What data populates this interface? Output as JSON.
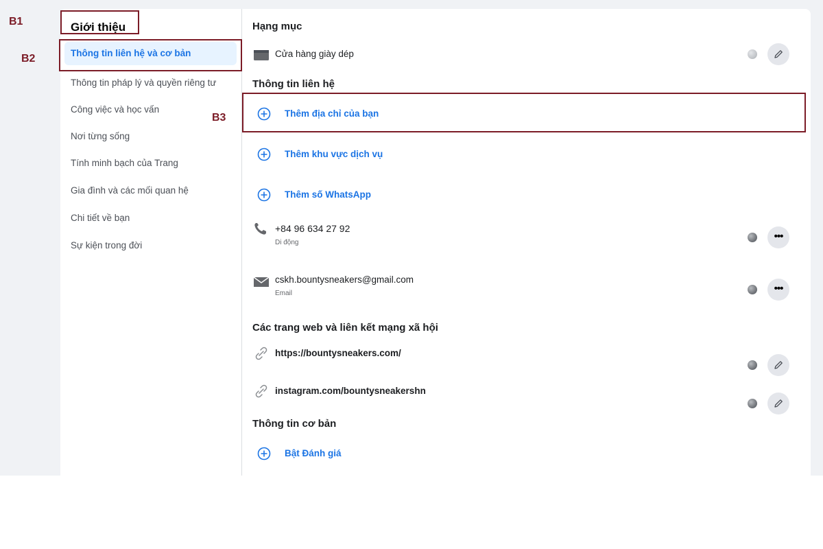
{
  "sidebar": {
    "title": "Giới thiệu",
    "items": [
      {
        "label": "Thông tin liên hệ và cơ bản",
        "active": true
      },
      {
        "label": "Thông tin pháp lý và quyền riêng tư"
      },
      {
        "label": "Công việc và học vấn"
      },
      {
        "label": "Nơi từng sống"
      },
      {
        "label": "Tính minh bạch của Trang"
      },
      {
        "label": "Gia đình và các mối quan hệ"
      },
      {
        "label": "Chi tiết về bạn"
      },
      {
        "label": "Sự kiện trong đời"
      }
    ]
  },
  "main": {
    "category": {
      "heading": "Hạng mục",
      "value": "Cửa hàng giày dép",
      "icon": "store-icon"
    },
    "contact": {
      "heading": "Thông tin liên hệ",
      "add_address": "Thêm địa chỉ của bạn",
      "add_service_area": "Thêm khu vực dịch vụ",
      "add_whatsapp": "Thêm số WhatsApp",
      "phone": {
        "value": "+84 96 634 27 92",
        "label": "Di động",
        "icon": "phone-icon"
      },
      "email": {
        "value": "cskh.bountysneakers@gmail.com",
        "label": "Email",
        "icon": "envelope-icon"
      }
    },
    "websites": {
      "heading": "Các trang web và liên kết mạng xã hội",
      "links": [
        "https://bountysneakers.com/",
        "instagram.com/bountysneakershn"
      ]
    },
    "basic": {
      "heading": "Thông tin cơ bản",
      "enable_reviews": "Bật Đánh giá"
    }
  },
  "annotations": {
    "b1": "B1",
    "b2": "B2",
    "b3": "B3"
  },
  "colors": {
    "accent": "#1b74e4",
    "annotation": "#7b1b26",
    "page_bg": "#f0f2f5"
  }
}
